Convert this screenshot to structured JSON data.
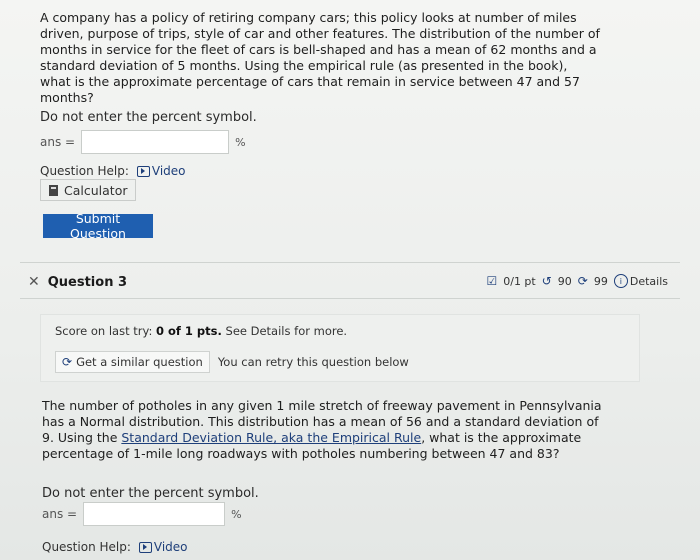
{
  "q1": {
    "text": "A company has a policy of retiring company cars; this policy looks at number of miles driven, purpose of trips, style of car and other features. The distribution of the number of months in service for the fleet of cars is bell-shaped and has a mean of 62 months and a standard deviation of 5 months. Using the empirical rule (as presented in the book), what is the approximate percentage of cars that remain in service between 47 and 57 months?",
    "instruction": "Do not enter the percent symbol.",
    "ans_label": "ans =",
    "ans_value": "",
    "pct": "%",
    "help_label": "Question Help:",
    "video_label": "Video",
    "calculator_label": "Calculator",
    "submit_label": "Submit Question"
  },
  "q3": {
    "title": "Question 3",
    "points": "0/1 pt",
    "retries": "90",
    "attempts": "99",
    "details_label": "Details",
    "score_prefix": "Score on last try: ",
    "score_value": "0 of 1 pts.",
    "score_suffix": " See Details for more.",
    "similar_label": "Get a similar question",
    "retry_text": "You can retry this question below",
    "text_part1": "The number of potholes in any given 1 mile stretch of freeway pavement in Pennsylvania has a Normal distribution. This distribution has a mean of 56 and a standard deviation of 9. Using the ",
    "link_text": "Standard Deviation Rule, aka the Empirical Rule",
    "text_part2": ", what is the approximate percentage of 1-mile long roadways with potholes numbering between 47 and 83?",
    "instruction": "Do not enter the percent symbol.",
    "ans_label": "ans =",
    "ans_value": "",
    "pct": "%",
    "help_label": "Question Help:",
    "video_label": "Video"
  },
  "icons": {
    "close": "close-icon",
    "points": "checkbox-icon",
    "retries": "undo-icon",
    "attempts": "refresh-icon",
    "details": "info-icon",
    "similar": "refresh-icon",
    "video": "video-icon",
    "calculator": "calculator-icon"
  },
  "colors": {
    "accent": "#1f5fb0",
    "link": "#1e3f7a"
  }
}
